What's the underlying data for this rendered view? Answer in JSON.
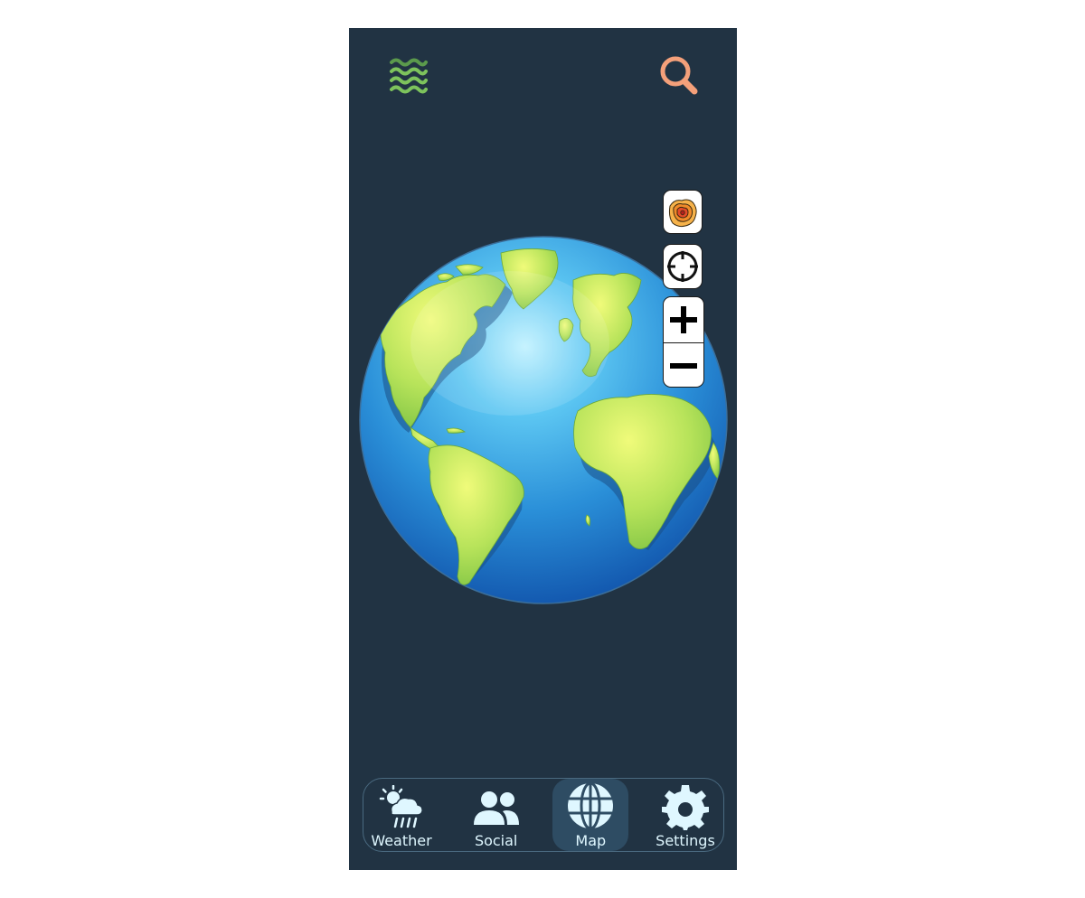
{
  "header": {
    "layers_icon": "layers-waves-icon",
    "search_icon": "search-icon",
    "layers_color": "#7dc35c",
    "search_color": "#f4a07a"
  },
  "map": {
    "view": "globe",
    "controls": {
      "heatmap_icon": "heatmap-icon",
      "locate_icon": "crosshair-icon",
      "zoom_in_icon": "plus-icon",
      "zoom_out_icon": "minus-icon"
    }
  },
  "tabs": [
    {
      "label": "Weather",
      "icon": "weather-icon",
      "active": false
    },
    {
      "label": "Social",
      "icon": "people-icon",
      "active": false
    },
    {
      "label": "Map",
      "icon": "globe-icon",
      "active": true
    },
    {
      "label": "Settings",
      "icon": "gear-icon",
      "active": false
    }
  ],
  "colors": {
    "background": "#213343",
    "tab_text": "#dff7ff",
    "active_tab": "#2e4c63"
  }
}
